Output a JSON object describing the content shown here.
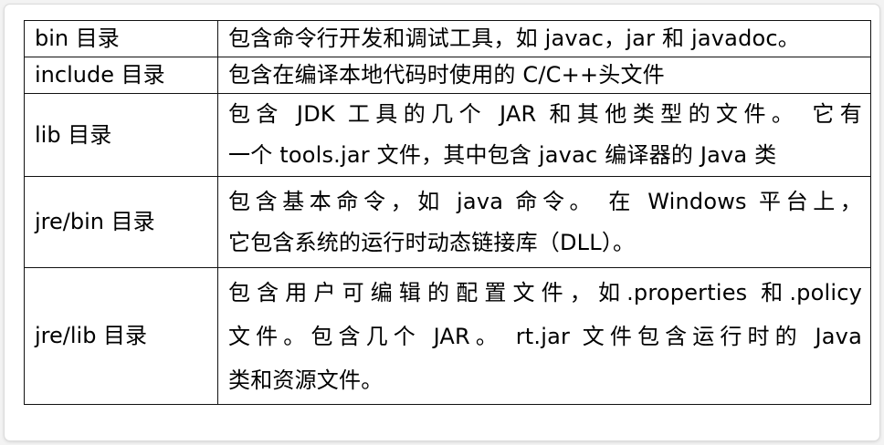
{
  "table": {
    "rows": [
      {
        "name": "bin  目录",
        "lines": [
          "包含命令行开发和调试工具，如 javac，jar 和 javadoc。"
        ]
      },
      {
        "name": "include 目录",
        "lines": [
          "包含在编译本地代码时使用的 C/C++头文件"
        ]
      },
      {
        "name": "lib  目录",
        "lines": [
          "包含 JDK 工具的几个 JAR 和其他类型的文件。 它有",
          "一个 tools.jar 文件，其中包含 javac 编译器的 Java 类"
        ]
      },
      {
        "name": "jre/bin  目录",
        "lines": [
          "包含基本命令，如 java 命令。 在 Windows 平台上，",
          "它包含系统的运行时动态链接库（DLL）。"
        ]
      },
      {
        "name": "jre/lib  目录",
        "lines": [
          "包含用户可编辑的配置文件，如.properties  和.policy",
          "文件。包含几个 JAR。 rt.jar 文件包含运行时的 Java",
          "类和资源文件。"
        ]
      }
    ]
  }
}
